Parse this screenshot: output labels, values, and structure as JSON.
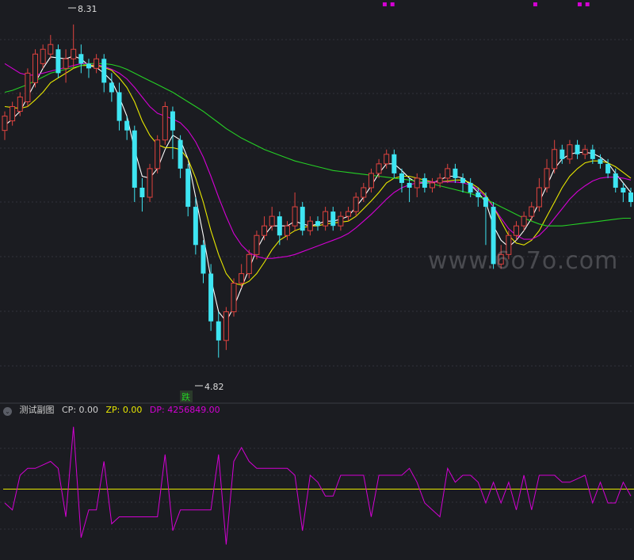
{
  "main_panel": {
    "high_label": "8.31",
    "low_label": "4.82",
    "signal_badge": "跌",
    "watermark": "www.6o7o.com",
    "colors": {
      "up": "#e0433f",
      "down": "#3ee5f2",
      "ma_white": "#ffffff",
      "ma_yellow": "#e8e800",
      "ma_magenta": "#d400d4",
      "ma_green": "#25d025",
      "bg": "#1b1c21",
      "grid": "#30323a"
    }
  },
  "sub_panel": {
    "title": "测试副图",
    "cp_label": "CP: 0.00",
    "zp_label": "ZP: 0.00",
    "dp_label": "DP: 4256849.00",
    "colors": {
      "title": "#d0d0d0",
      "cp": "#d0d0d0",
      "zp": "#e8e800",
      "dp": "#d400d4"
    }
  },
  "chart_data": [
    {
      "type": "candlestick",
      "title": "",
      "y_range": [
        4.6,
        8.5
      ],
      "annotations": [
        {
          "text": "8.31",
          "value": 8.31
        },
        {
          "text": "4.82",
          "value": 4.82
        }
      ],
      "candles": [
        [
          7.2,
          7.35,
          7.1,
          7.4
        ],
        [
          7.3,
          7.45,
          7.25,
          7.5
        ],
        [
          7.4,
          7.55,
          7.35,
          7.6
        ],
        [
          7.5,
          7.8,
          7.45,
          7.85
        ],
        [
          7.7,
          8.0,
          7.65,
          8.05
        ],
        [
          7.9,
          8.05,
          7.85,
          8.1
        ],
        [
          8.0,
          8.1,
          7.95,
          8.2
        ],
        [
          8.05,
          7.8,
          7.75,
          8.1
        ],
        [
          7.85,
          7.95,
          7.7,
          8.05
        ],
        [
          7.95,
          8.05,
          7.85,
          8.31
        ],
        [
          8.0,
          7.9,
          7.8,
          8.1
        ],
        [
          7.9,
          7.85,
          7.75,
          7.95
        ],
        [
          7.85,
          7.95,
          7.8,
          8.0
        ],
        [
          7.95,
          7.7,
          7.6,
          8.0
        ],
        [
          7.7,
          7.6,
          7.5,
          7.8
        ],
        [
          7.6,
          7.3,
          7.2,
          7.7
        ],
        [
          7.3,
          7.2,
          7.1,
          7.35
        ],
        [
          7.2,
          6.6,
          6.45,
          7.25
        ],
        [
          6.6,
          6.5,
          6.35,
          6.7
        ],
        [
          6.5,
          6.8,
          6.45,
          6.85
        ],
        [
          6.8,
          7.1,
          6.75,
          7.15
        ],
        [
          7.1,
          7.45,
          7.05,
          7.5
        ],
        [
          7.4,
          7.2,
          6.9,
          7.45
        ],
        [
          7.1,
          6.8,
          6.7,
          7.15
        ],
        [
          6.8,
          6.4,
          6.3,
          6.85
        ],
        [
          6.4,
          6.0,
          5.9,
          6.5
        ],
        [
          6.0,
          5.7,
          5.6,
          6.05
        ],
        [
          5.7,
          5.2,
          5.1,
          5.8
        ],
        [
          5.2,
          5.0,
          4.82,
          5.3
        ],
        [
          5.0,
          5.3,
          4.9,
          5.35
        ],
        [
          5.3,
          5.6,
          5.25,
          5.65
        ],
        [
          5.6,
          5.7,
          5.55,
          5.8
        ],
        [
          5.7,
          5.9,
          5.65,
          5.95
        ],
        [
          5.9,
          6.1,
          5.85,
          6.15
        ],
        [
          6.1,
          6.2,
          6.05,
          6.3
        ],
        [
          6.2,
          6.3,
          6.15,
          6.4
        ],
        [
          6.3,
          6.1,
          6.0,
          6.35
        ],
        [
          6.1,
          6.2,
          6.05,
          6.25
        ],
        [
          6.2,
          6.4,
          6.15,
          6.55
        ],
        [
          6.4,
          6.15,
          6.1,
          6.45
        ],
        [
          6.15,
          6.25,
          6.1,
          6.3
        ],
        [
          6.25,
          6.2,
          6.15,
          6.3
        ],
        [
          6.2,
          6.35,
          6.15,
          6.4
        ],
        [
          6.35,
          6.2,
          6.15,
          6.4
        ],
        [
          6.2,
          6.3,
          6.15,
          6.35
        ],
        [
          6.3,
          6.35,
          6.25,
          6.4
        ],
        [
          6.35,
          6.5,
          6.3,
          6.55
        ],
        [
          6.5,
          6.6,
          6.45,
          6.65
        ],
        [
          6.6,
          6.75,
          6.55,
          6.8
        ],
        [
          6.75,
          6.85,
          6.7,
          6.9
        ],
        [
          6.85,
          6.95,
          6.8,
          7.0
        ],
        [
          6.95,
          6.75,
          6.7,
          7.0
        ],
        [
          6.75,
          6.65,
          6.55,
          6.8
        ],
        [
          6.65,
          6.6,
          6.45,
          6.7
        ],
        [
          6.6,
          6.7,
          6.5,
          6.75
        ],
        [
          6.7,
          6.6,
          6.55,
          6.75
        ],
        [
          6.6,
          6.65,
          6.55,
          6.7
        ],
        [
          6.65,
          6.7,
          6.6,
          6.75
        ],
        [
          6.7,
          6.8,
          6.65,
          6.85
        ],
        [
          6.8,
          6.7,
          6.65,
          6.85
        ],
        [
          6.7,
          6.65,
          6.55,
          6.75
        ],
        [
          6.65,
          6.55,
          6.5,
          6.7
        ],
        [
          6.55,
          6.5,
          6.4,
          6.6
        ],
        [
          6.5,
          6.4,
          6.0,
          6.55
        ],
        [
          6.4,
          5.8,
          5.75,
          6.45
        ],
        [
          5.8,
          5.9,
          5.75,
          6.0
        ],
        [
          5.9,
          6.1,
          5.85,
          6.15
        ],
        [
          6.1,
          6.2,
          6.05,
          6.25
        ],
        [
          6.2,
          6.3,
          6.15,
          6.35
        ],
        [
          6.3,
          6.4,
          6.25,
          6.45
        ],
        [
          6.4,
          6.6,
          6.35,
          6.7
        ],
        [
          6.6,
          6.8,
          6.55,
          6.9
        ],
        [
          6.8,
          7.0,
          6.75,
          7.1
        ],
        [
          7.0,
          6.9,
          6.85,
          7.05
        ],
        [
          6.9,
          7.05,
          6.85,
          7.1
        ],
        [
          7.05,
          6.95,
          6.9,
          7.1
        ],
        [
          6.95,
          7.0,
          6.9,
          7.05
        ],
        [
          7.0,
          6.9,
          6.85,
          7.05
        ],
        [
          6.9,
          6.85,
          6.8,
          6.95
        ],
        [
          6.85,
          6.75,
          6.7,
          6.9
        ],
        [
          6.75,
          6.6,
          6.55,
          6.8
        ],
        [
          6.6,
          6.55,
          6.45,
          6.65
        ],
        [
          6.55,
          6.45,
          6.4,
          6.6
        ]
      ],
      "series": [
        {
          "color": "#ffffff",
          "values": [
            7.25,
            7.32,
            7.4,
            7.55,
            7.7,
            7.85,
            7.97,
            7.96,
            7.95,
            7.98,
            7.95,
            7.88,
            7.86,
            7.8,
            7.72,
            7.55,
            7.35,
            7.0,
            6.72,
            6.7,
            6.8,
            7.0,
            7.15,
            7.1,
            6.9,
            6.5,
            6.1,
            5.65,
            5.3,
            5.2,
            5.35,
            5.55,
            5.75,
            5.95,
            6.1,
            6.2,
            6.2,
            6.2,
            6.25,
            6.22,
            6.2,
            6.22,
            6.25,
            6.25,
            6.27,
            6.3,
            6.4,
            6.5,
            6.62,
            6.75,
            6.85,
            6.85,
            6.78,
            6.7,
            6.65,
            6.65,
            6.65,
            6.68,
            6.72,
            6.72,
            6.7,
            6.63,
            6.55,
            6.45,
            6.2,
            6.05,
            5.98,
            6.05,
            6.15,
            6.28,
            6.45,
            6.62,
            6.8,
            6.9,
            6.95,
            6.97,
            6.97,
            6.96,
            6.92,
            6.86,
            6.75,
            6.65,
            6.55
          ]
        },
        {
          "color": "#e8e800",
          "values": [
            7.45,
            7.44,
            7.43,
            7.45,
            7.52,
            7.6,
            7.7,
            7.75,
            7.8,
            7.85,
            7.88,
            7.88,
            7.88,
            7.86,
            7.83,
            7.75,
            7.65,
            7.5,
            7.3,
            7.15,
            7.05,
            7.02,
            7.02,
            7.0,
            6.9,
            6.7,
            6.45,
            6.15,
            5.9,
            5.7,
            5.6,
            5.58,
            5.62,
            5.7,
            5.82,
            5.95,
            6.05,
            6.1,
            6.15,
            6.18,
            6.2,
            6.2,
            6.22,
            6.23,
            6.24,
            6.25,
            6.3,
            6.38,
            6.46,
            6.55,
            6.65,
            6.7,
            6.72,
            6.72,
            6.7,
            6.68,
            6.66,
            6.66,
            6.67,
            6.68,
            6.68,
            6.65,
            6.6,
            6.52,
            6.4,
            6.25,
            6.1,
            6.02,
            6.0,
            6.05,
            6.15,
            6.3,
            6.45,
            6.6,
            6.72,
            6.8,
            6.86,
            6.88,
            6.88,
            6.86,
            6.82,
            6.76,
            6.7
          ]
        },
        {
          "color": "#d400d4",
          "values": [
            7.9,
            7.85,
            7.8,
            7.78,
            7.78,
            7.8,
            7.82,
            7.84,
            7.86,
            7.88,
            7.9,
            7.9,
            7.89,
            7.87,
            7.84,
            7.8,
            7.74,
            7.65,
            7.55,
            7.45,
            7.38,
            7.35,
            7.32,
            7.28,
            7.2,
            7.08,
            6.92,
            6.72,
            6.5,
            6.3,
            6.12,
            6.0,
            5.92,
            5.88,
            5.86,
            5.86,
            5.87,
            5.88,
            5.9,
            5.93,
            5.96,
            5.99,
            6.02,
            6.05,
            6.08,
            6.12,
            6.18,
            6.25,
            6.32,
            6.4,
            6.48,
            6.55,
            6.6,
            6.63,
            6.65,
            6.66,
            6.66,
            6.66,
            6.66,
            6.66,
            6.65,
            6.63,
            6.58,
            6.5,
            6.4,
            6.28,
            6.17,
            6.1,
            6.06,
            6.06,
            6.1,
            6.18,
            6.28,
            6.38,
            6.48,
            6.56,
            6.62,
            6.67,
            6.7,
            6.71,
            6.71,
            6.7,
            6.68
          ]
        },
        {
          "color": "#25d025",
          "values": [
            7.6,
            7.62,
            7.65,
            7.68,
            7.72,
            7.76,
            7.8,
            7.82,
            7.84,
            7.86,
            7.88,
            7.9,
            7.9,
            7.9,
            7.89,
            7.87,
            7.84,
            7.8,
            7.76,
            7.72,
            7.68,
            7.64,
            7.6,
            7.55,
            7.5,
            7.45,
            7.4,
            7.34,
            7.28,
            7.22,
            7.17,
            7.12,
            7.08,
            7.04,
            7.0,
            6.97,
            6.94,
            6.91,
            6.88,
            6.86,
            6.84,
            6.82,
            6.8,
            6.78,
            6.77,
            6.76,
            6.75,
            6.74,
            6.73,
            6.72,
            6.71,
            6.7,
            6.69,
            6.68,
            6.67,
            6.66,
            6.64,
            6.62,
            6.6,
            6.58,
            6.56,
            6.54,
            6.51,
            6.48,
            6.44,
            6.4,
            6.36,
            6.32,
            6.28,
            6.25,
            6.22,
            6.2,
            6.2,
            6.2,
            6.21,
            6.22,
            6.23,
            6.24,
            6.25,
            6.26,
            6.27,
            6.28,
            6.28
          ]
        }
      ]
    },
    {
      "type": "line",
      "title": "测试副图",
      "y_range": [
        -1,
        1
      ],
      "reference_line": {
        "value": 0,
        "color": "#e8e800"
      },
      "series": [
        {
          "name": "DP",
          "color": "#d400d4",
          "values": [
            -0.2,
            -0.3,
            0.2,
            0.3,
            0.3,
            0.35,
            0.4,
            0.3,
            -0.4,
            0.9,
            -0.7,
            -0.3,
            -0.3,
            0.4,
            -0.5,
            -0.4,
            -0.4,
            -0.4,
            -0.4,
            -0.4,
            -0.4,
            0.5,
            -0.6,
            -0.3,
            -0.3,
            -0.3,
            -0.3,
            -0.3,
            0.5,
            -0.8,
            0.4,
            0.6,
            0.4,
            0.3,
            0.3,
            0.3,
            0.3,
            0.3,
            0.2,
            -0.6,
            0.2,
            0.1,
            -0.1,
            -0.1,
            0.2,
            0.2,
            0.2,
            0.2,
            -0.4,
            0.2,
            0.2,
            0.2,
            0.2,
            0.3,
            0.1,
            -0.2,
            -0.3,
            -0.4,
            0.3,
            0.1,
            0.2,
            0.2,
            0.1,
            -0.2,
            0.1,
            -0.2,
            0.1,
            -0.3,
            0.2,
            -0.3,
            0.2,
            0.2,
            0.2,
            0.1,
            0.1,
            0.15,
            0.2,
            -0.2,
            0.1,
            -0.2,
            -0.2,
            0.1,
            -0.1
          ]
        }
      ]
    }
  ]
}
